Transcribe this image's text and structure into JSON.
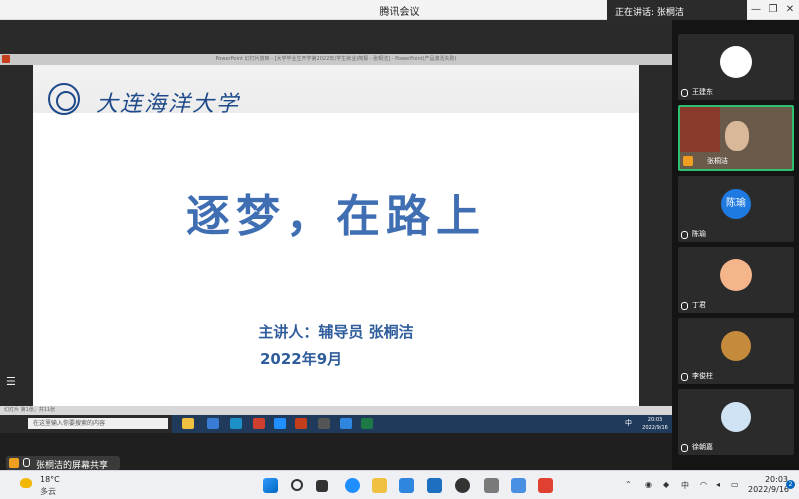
{
  "window": {
    "title": "腾讯会议",
    "speaking_label": "正在讲话: 张桐洁"
  },
  "presentation": {
    "window_title": "PowerPoint 幻灯片放映 - [大学毕业生开学第2022年(学生就业)简报 - 张桐洁] - PowerPoint(产品激活失败)",
    "logo_text": "大连海洋大学",
    "main_title": "逐梦，在路上",
    "speaker_line": "主讲人：辅导员 张桐洁",
    "date": "2022年9月",
    "status_text": "幻灯片 第1张，共11张"
  },
  "inner_taskbar": {
    "search_placeholder": "在这里输入你要搜索的内容",
    "clock_time": "20:03",
    "clock_date": "2022/9/16",
    "ime": "中"
  },
  "share": {
    "label": "张桐洁的屏幕共享"
  },
  "participants": [
    {
      "name": "王建东",
      "avatar": "cartoon-person",
      "color": "#ffffff"
    },
    {
      "name": "张桐洁",
      "avatar": "video",
      "active": true
    },
    {
      "name": "陈瑜",
      "avatar": "text",
      "avatar_text": "陈瑜",
      "color": "#1e7ae0"
    },
    {
      "name": "丁君",
      "avatar": "cartoon-person",
      "color": "#f5b58a"
    },
    {
      "name": "李俊柱",
      "avatar": "photo",
      "color": "#c58a3c"
    },
    {
      "name": "徐朝嘉",
      "avatar": "photo",
      "color": "#cfe3f5"
    }
  ],
  "taskbar": {
    "weather_temp": "18°C",
    "weather_desc": "多云",
    "time": "20:03",
    "date": "2022/9/16",
    "notifications": "2",
    "ime": "中"
  }
}
